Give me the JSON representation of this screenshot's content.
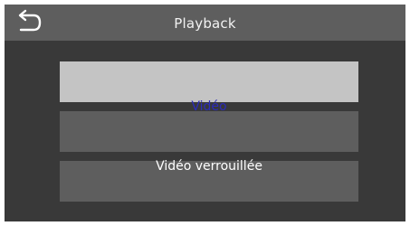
{
  "header": {
    "title": "Playback",
    "back_icon": "back-arrow-icon"
  },
  "menu": {
    "items": [
      {
        "label": "Vidéo",
        "selected": true
      },
      {
        "label": "Vidéo verrouillée",
        "selected": false
      }
    ]
  },
  "colors": {
    "background": "#393939",
    "header": "#5e5e5e",
    "item": "#5e5e5e",
    "item_selected": "#c4c4c4",
    "selected_text": "#2c2cba",
    "text": "#ffffff"
  }
}
